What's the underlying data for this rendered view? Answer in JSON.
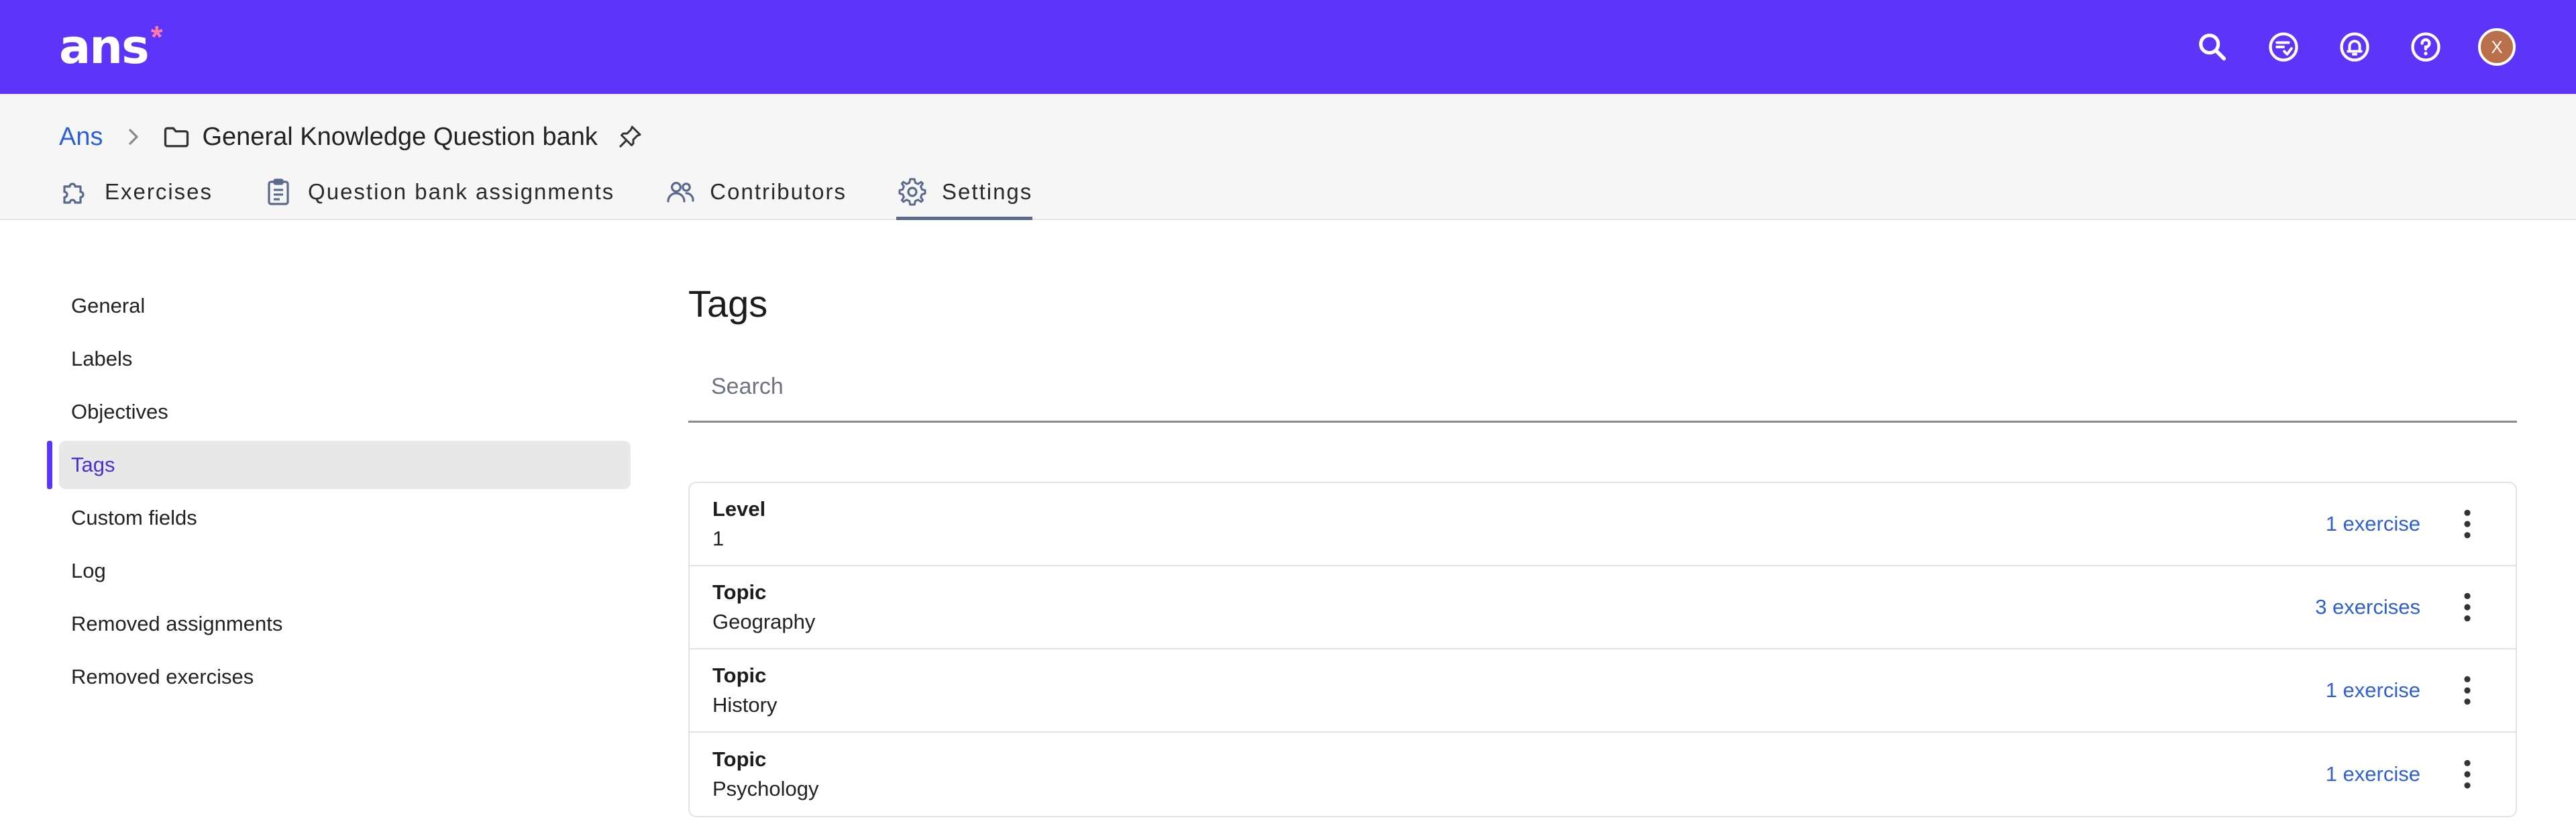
{
  "app": {
    "logo_text": "ans",
    "logo_mark": "*",
    "avatar_initial": "X"
  },
  "top_icons": [
    "search-icon",
    "review-icon",
    "notifications-icon",
    "help-icon"
  ],
  "breadcrumb": {
    "root": "Ans",
    "current": "General Knowledge Question bank"
  },
  "tabs": [
    {
      "label": "Exercises",
      "icon": "puzzle-icon"
    },
    {
      "label": "Question bank assignments",
      "icon": "clipboard-icon"
    },
    {
      "label": "Contributors",
      "icon": "people-icon"
    },
    {
      "label": "Settings",
      "icon": "gear-icon",
      "active": true
    }
  ],
  "sidebar": {
    "items": [
      {
        "label": "General"
      },
      {
        "label": "Labels"
      },
      {
        "label": "Objectives"
      },
      {
        "label": "Tags",
        "active": true
      },
      {
        "label": "Custom fields"
      },
      {
        "label": "Log"
      },
      {
        "label": "Removed assignments"
      },
      {
        "label": "Removed exercises"
      }
    ]
  },
  "main": {
    "title": "Tags",
    "search_placeholder": "Search",
    "tags": [
      {
        "category": "Level",
        "value": "1",
        "count": "1 exercise"
      },
      {
        "category": "Topic",
        "value": "Geography",
        "count": "3 exercises"
      },
      {
        "category": "Topic",
        "value": "History",
        "count": "1 exercise"
      },
      {
        "category": "Topic",
        "value": "Psychology",
        "count": "1 exercise"
      }
    ]
  },
  "colors": {
    "brand": "#5d34f9",
    "link": "#2f5fd6",
    "logo_mark": "#ff7aa8"
  }
}
